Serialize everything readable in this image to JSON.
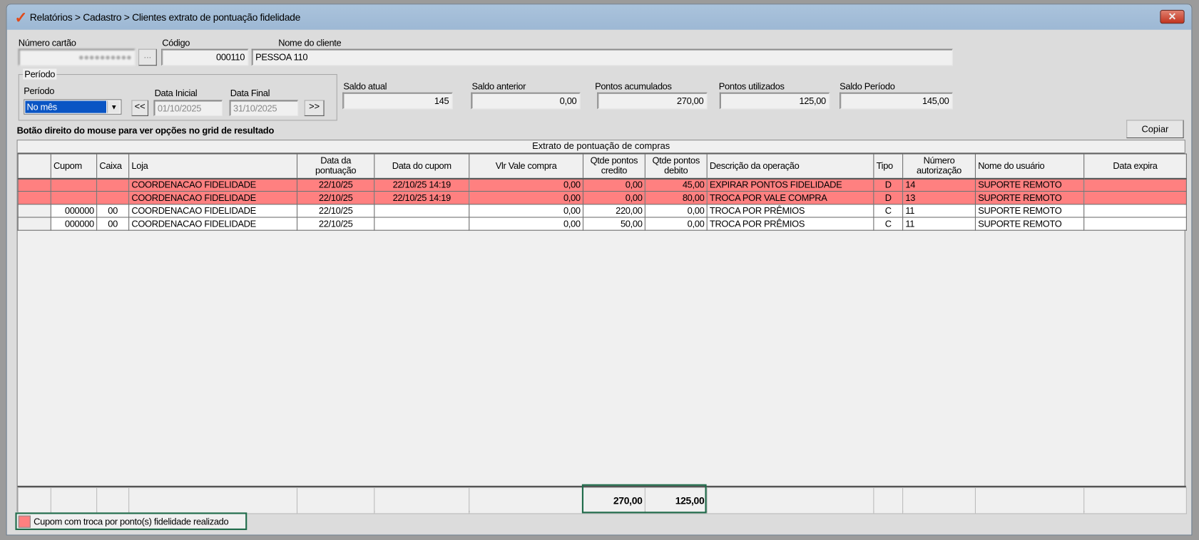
{
  "window": {
    "title": "Relatórios > Cadastro > Clientes extrato de pontuação fidelidade",
    "close": "✕"
  },
  "client": {
    "card_label": "Número cartão",
    "card_value": "●●●●●●●●●●",
    "browse": "...",
    "code_label": "Código",
    "code_value": "000110",
    "name_label": "Nome do cliente",
    "name_value": "PESSOA 110"
  },
  "period": {
    "group": "Período",
    "label": "Período",
    "value": "No mês",
    "prev": "<<",
    "next": ">>",
    "start_label": "Data Inicial",
    "start": "01/10/2025",
    "end_label": "Data Final",
    "end": "31/10/2025"
  },
  "balances": [
    {
      "label": "Saldo atual",
      "value": "145"
    },
    {
      "label": "Saldo anterior",
      "value": "0,00"
    },
    {
      "label": "Pontos acumulados",
      "value": "270,00"
    },
    {
      "label": "Pontos utilizados",
      "value": "125,00"
    },
    {
      "label": "Saldo Período",
      "value": "145,00"
    }
  ],
  "hint": "Botão direito do mouse para ver opções no grid de resultado",
  "copy": "Copiar",
  "grid": {
    "caption": "Extrato de pontuação de compras",
    "columns": [
      "",
      "Cupom",
      "Caixa",
      "Loja",
      "Data da pontuação",
      "Data do cupom",
      "Vlr Vale compra",
      "Qtde pontos credito",
      "Qtde pontos debito",
      "Descrição da operação",
      "Tipo",
      "Número autorização",
      "Nome do usuário",
      "Data expira"
    ],
    "rows": [
      {
        "highlight": true,
        "cells": [
          "",
          "",
          "",
          "COORDENACAO FIDELIDADE",
          "22/10/25",
          "22/10/25 14:19",
          "0,00",
          "0,00",
          "45,00",
          "EXPIRAR PONTOS FIDELIDADE",
          "D",
          "14",
          "SUPORTE REMOTO",
          ""
        ]
      },
      {
        "highlight": true,
        "cells": [
          "",
          "",
          "",
          "COORDENACAO FIDELIDADE",
          "22/10/25",
          "22/10/25 14:19",
          "0,00",
          "0,00",
          "80,00",
          "TROCA POR VALE COMPRA",
          "D",
          "13",
          "SUPORTE REMOTO",
          ""
        ]
      },
      {
        "highlight": false,
        "cells": [
          "",
          "000000",
          "00",
          "COORDENACAO FIDELIDADE",
          "22/10/25",
          "",
          "0,00",
          "220,00",
          "0,00",
          "TROCA POR PRÊMIOS",
          "C",
          "11",
          "SUPORTE REMOTO",
          ""
        ]
      },
      {
        "highlight": false,
        "cells": [
          "",
          "000000",
          "00",
          "COORDENACAO FIDELIDADE",
          "22/10/25",
          "",
          "0,00",
          "50,00",
          "0,00",
          "TROCA POR PRÊMIOS",
          "C",
          "11",
          "SUPORTE REMOTO",
          ""
        ]
      }
    ],
    "totals": {
      "credit": "270,00",
      "debit": "125,00"
    }
  },
  "legend": "Cupom com troca por ponto(s) fidelidade realizado",
  "colors": {
    "highlight": "#ff8080",
    "accent": "#1f6b4a"
  }
}
